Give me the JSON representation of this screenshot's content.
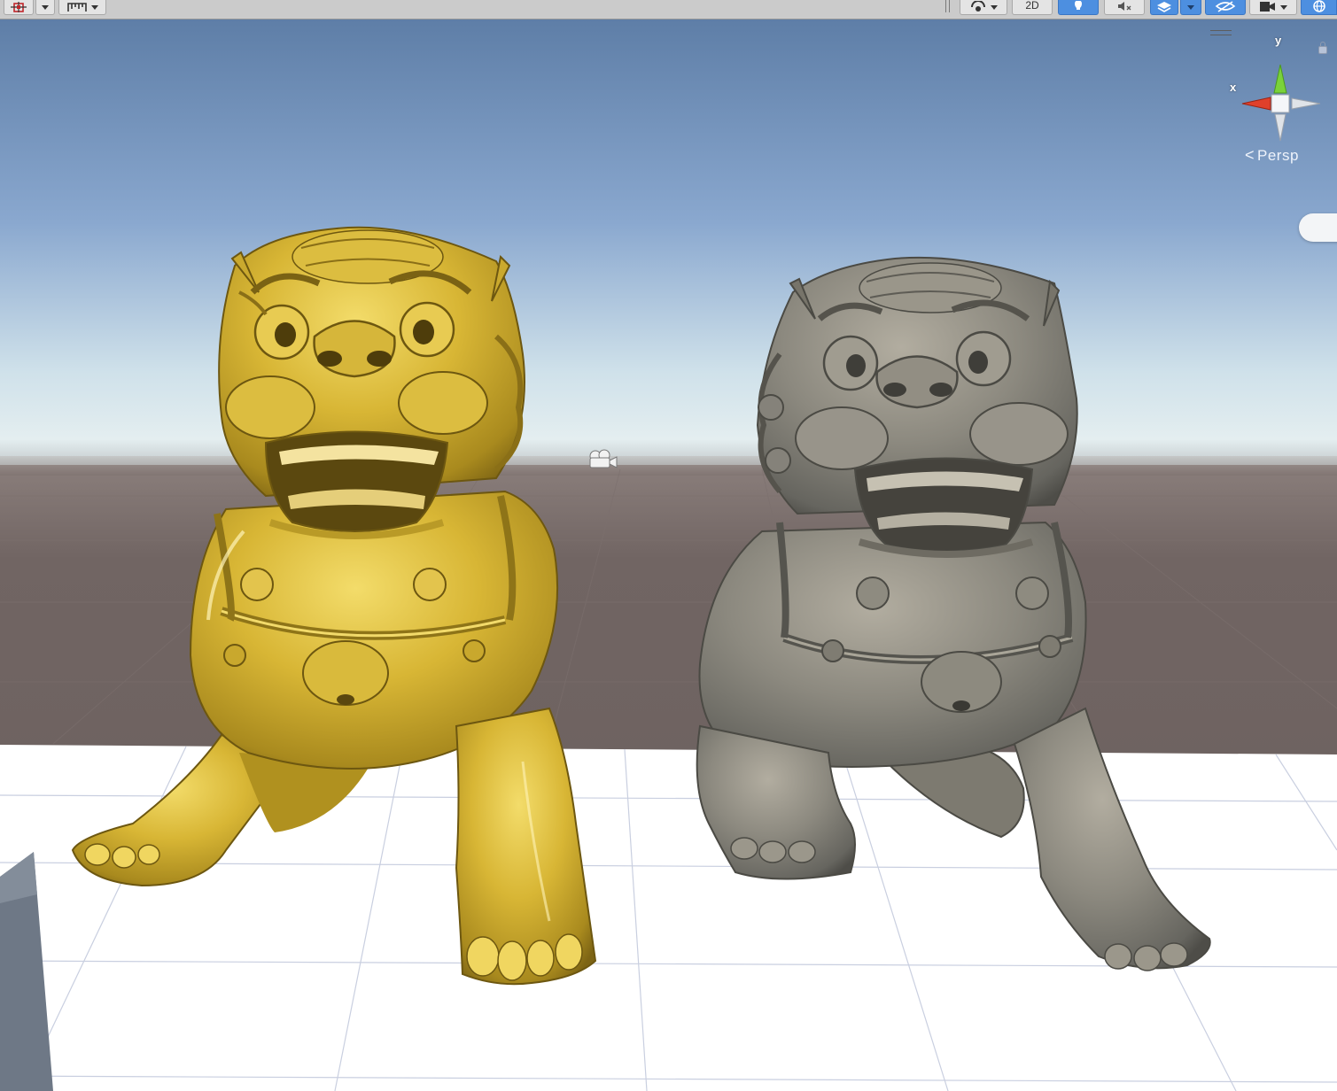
{
  "toolbar": {
    "buttons": [
      {
        "name": "gizmo-tools",
        "icon": "transform-tools-icon"
      },
      {
        "name": "grid-snap",
        "icon": "grid-ruler-icon"
      },
      {
        "name": "shading-mode",
        "icon": "shading-sphere-icon"
      },
      {
        "name": "toggle-2d",
        "label": "2D"
      },
      {
        "name": "lighting",
        "icon": "lightbulb-icon",
        "active": true
      },
      {
        "name": "audio",
        "icon": "audio-mute-icon"
      },
      {
        "name": "effects",
        "icon": "layers-icon",
        "active": true
      },
      {
        "name": "scene-visibility",
        "icon": "eye-slash-icon",
        "active": true
      },
      {
        "name": "scene-camera",
        "icon": "camera-icon"
      },
      {
        "name": "gizmos",
        "icon": "globe-icon",
        "active": true
      }
    ],
    "toggle_2d_label": "2D"
  },
  "gizmo": {
    "y_label": "y",
    "x_label": "x",
    "projection_label": "Persp",
    "colors": {
      "x_axis": "#e0402b",
      "y_axis": "#7ad23a",
      "neutral": "#dfe3e8"
    }
  },
  "scene": {
    "sky_top": "#5f7fa8",
    "sky_horizon": "#dbe8ee",
    "ground": "#6f6361",
    "plane": "#ffffff",
    "objects": [
      {
        "name": "gold-lion-statue",
        "material_color": "#d4b032"
      },
      {
        "name": "stone-lion-statue",
        "material_color": "#8a8a82"
      }
    ]
  }
}
